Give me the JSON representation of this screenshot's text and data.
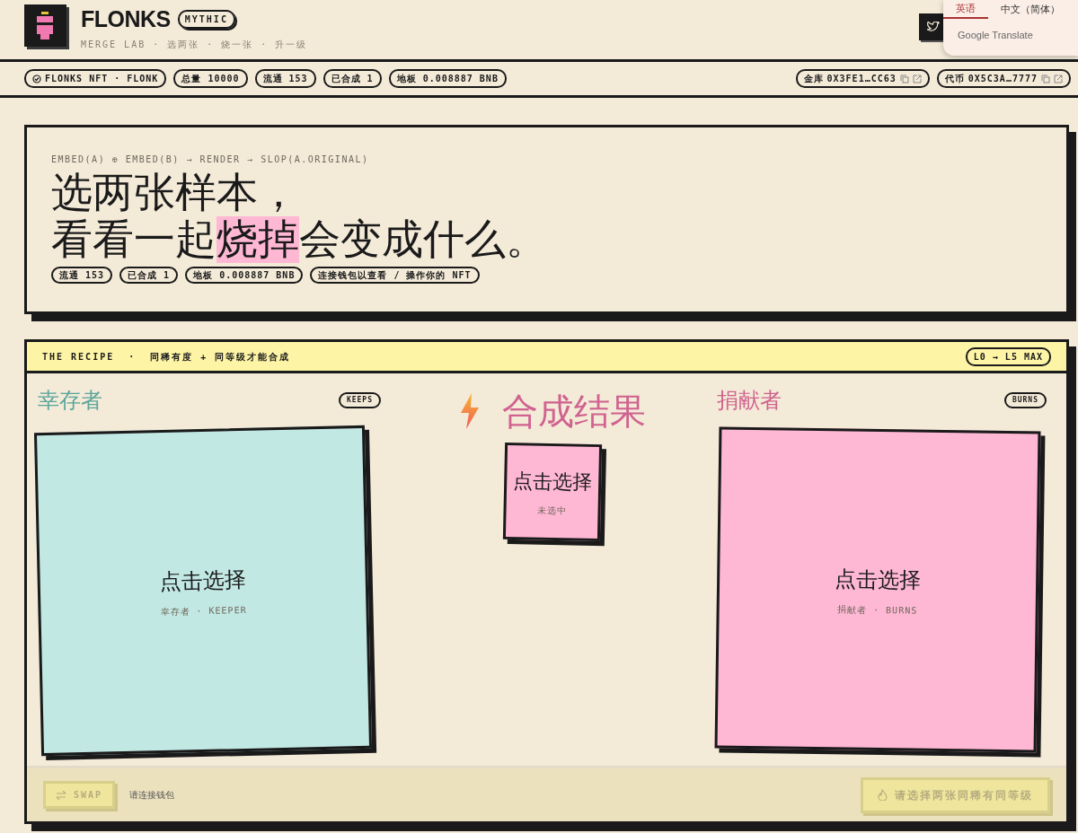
{
  "header": {
    "brand": "FLONKS",
    "tier": "MYTHIC",
    "tagline": "MERGE LAB · 选两张 · 烧一张 · 升一级"
  },
  "translate_popup": {
    "tabs": [
      {
        "label": "英语",
        "selected": true
      },
      {
        "label": "中文（简体）",
        "selected": false
      }
    ],
    "footer": "Google Translate"
  },
  "stats_bar": {
    "left": [
      {
        "kind": "verified",
        "text": "FLONKS NFT · FLONK"
      },
      {
        "kind": "plain",
        "text": "总量 10000"
      },
      {
        "kind": "plain",
        "text": "流通 153"
      },
      {
        "kind": "plain",
        "text": "已合成 1"
      },
      {
        "kind": "plain",
        "text": "地板 0.008887 BNB"
      }
    ],
    "right": [
      {
        "label": "金库",
        "value": "0X3FE1…CC63"
      },
      {
        "label": "代币",
        "value": "0X5C3A…7777"
      }
    ]
  },
  "hero": {
    "formula": "EMBED(A) ⊕ EMBED(B) → RENDER → SLOP(A.ORIGINAL)",
    "headline": [
      [
        {
          "text": "选两张样本，",
          "highlight": false
        }
      ],
      [
        {
          "text": "看看一起",
          "highlight": false
        },
        {
          "text": "烧掉",
          "highlight": true
        },
        {
          "text": "会变成什么。",
          "highlight": false
        }
      ]
    ],
    "pills": [
      "流通 153",
      "已合成 1",
      "地板 0.008887 BNB",
      "连接钱包以查看 / 操作你的 NFT"
    ]
  },
  "recipe": {
    "title": "THE RECIPE",
    "separator": "·",
    "rule": "同稀有度 + 同等级才能合成",
    "range": "L0 → L5 MAX",
    "slots": [
      {
        "kind": "keeper",
        "title": "幸存者",
        "tag": "KEEPS",
        "prompt": "点击选择",
        "caption": "幸存者 · KEEPER"
      },
      {
        "kind": "result",
        "title": "合成结果",
        "prompt": "点击选择",
        "caption": "未选中"
      },
      {
        "kind": "donor",
        "title": "捐献者",
        "tag": "BURNS",
        "prompt": "点击选择",
        "caption": "捐献者 · BURNS"
      }
    ],
    "footer": {
      "swap": {
        "label": "SWAP",
        "disabled": true
      },
      "wallet_hint": "请连接钱包",
      "merge": {
        "label": "请选择两张同稀有同等级",
        "disabled": true
      }
    }
  }
}
